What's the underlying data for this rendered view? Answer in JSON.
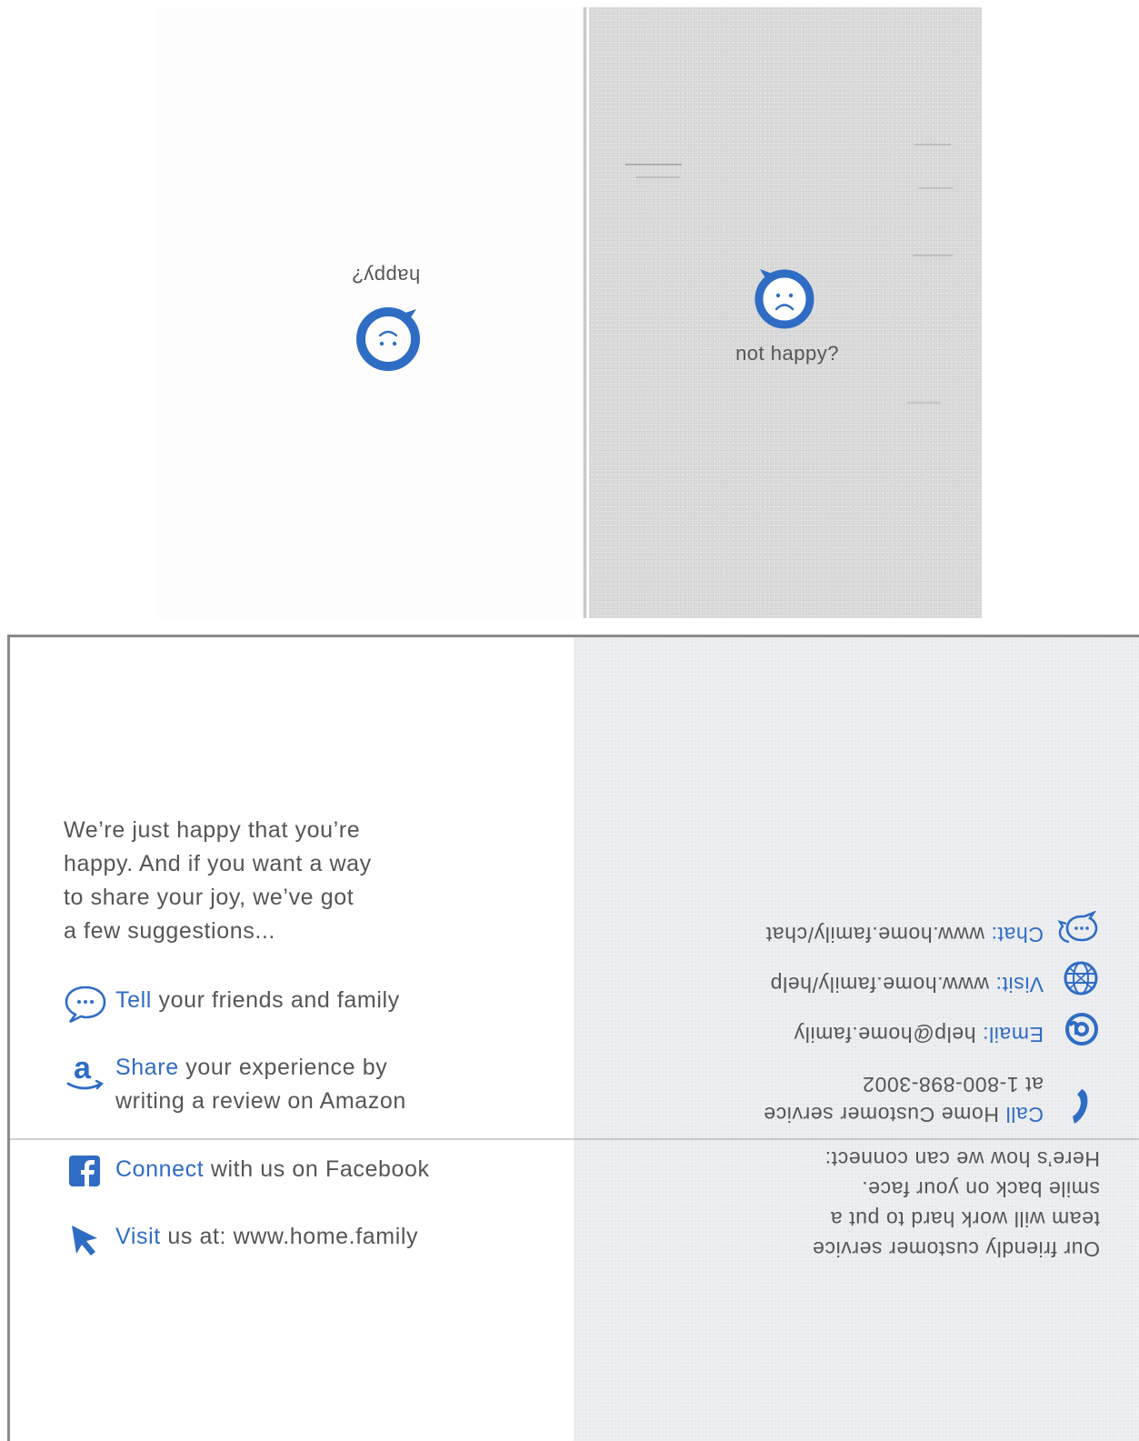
{
  "top": {
    "happy_label": "happy?",
    "not_happy_label": "not happy?"
  },
  "colors": {
    "accent": "#2f6cc4",
    "text": "#555555",
    "paper_gray": "#dcdcdc"
  },
  "bottom_left": {
    "intro_lines": [
      "We’re just happy that you’re",
      "happy. And if you want a way",
      "to share your joy, we’ve got",
      "a few suggestions..."
    ],
    "suggestions": [
      {
        "icon": "chat-bubble-icon",
        "action": "Tell",
        "rest": " your friends and family"
      },
      {
        "icon": "amazon-icon",
        "action": "Share",
        "rest": " your experience by",
        "rest2": "writing a review on Amazon"
      },
      {
        "icon": "facebook-icon",
        "action": "Connect",
        "rest": " with us on Facebook"
      },
      {
        "icon": "cursor-arrow-icon",
        "action": "Visit",
        "rest": " us at: www.home.family"
      }
    ]
  },
  "bottom_right": {
    "intro_lines": [
      "Our friendly customer service",
      "team will work hard to put a",
      "smile back on your face.",
      "Here’s how we can connect:"
    ],
    "contacts": [
      {
        "icon": "phone-icon",
        "label": "Call",
        "value": " Home Customer service",
        "value2": "at 1-800-898-3002"
      },
      {
        "icon": "at-sign-icon",
        "label": "Email:",
        "value": " help@home.family"
      },
      {
        "icon": "globe-icon",
        "label": "Visit:",
        "value": " www.home.family/help"
      },
      {
        "icon": "chat-bubbles-icon",
        "label": "Chat:",
        "value": " www.home.family/chat"
      }
    ]
  }
}
